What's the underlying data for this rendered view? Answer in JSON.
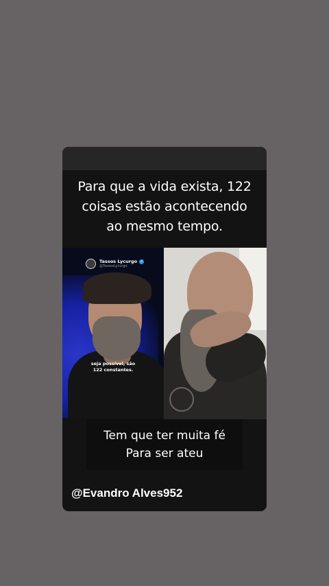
{
  "post": {
    "headline_lines": [
      "Para que a vida exista, 122",
      "coisas estão acontecendo",
      "ao mesmo tempo."
    ],
    "left_video": {
      "profile_name": "Tassos Lycurgo",
      "profile_handle": "@TassosLycurgo",
      "verified_icon": "verified-check-icon",
      "caption_lines": [
        "seja possível, são",
        "122 constantes."
      ]
    },
    "subtitle_lines": [
      "Tem que ter muita fé",
      "Para ser ateu"
    ],
    "watermark": "@Evandro Alves952"
  },
  "colors": {
    "page_background": "#676264",
    "card_background": "#131313",
    "verified_badge": "#2d9bf0"
  }
}
